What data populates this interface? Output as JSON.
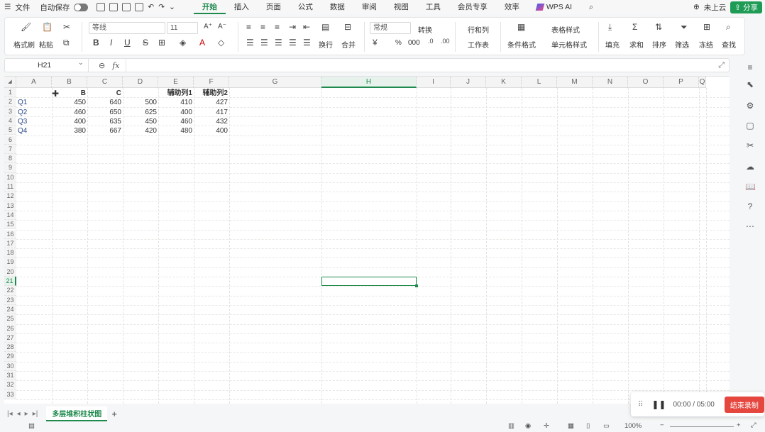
{
  "menu": {
    "file": "文件",
    "autosave": "自动保存",
    "tabs": [
      "开始",
      "插入",
      "页面",
      "公式",
      "数据",
      "审阅",
      "视图",
      "工具",
      "会员专享",
      "效率"
    ],
    "wps_ai": "WPS AI",
    "cloud": "未上云",
    "share": "分享"
  },
  "ribbon": {
    "format_painter": "格式刷",
    "paste": "粘贴",
    "font_name": "等线",
    "font_size": "11",
    "bold": "B",
    "italic": "I",
    "underline": "U",
    "strike": "S",
    "wrap": "换行",
    "merge": "合并",
    "number_format": "常规",
    "convert": "转换",
    "percent": "%",
    "thousands": "000",
    "row_col": "行和列",
    "worksheet": "工作表",
    "cond_format": "条件格式",
    "table_style": "表格样式",
    "cell_style": "单元格样式",
    "fill": "填充",
    "sum": "求和",
    "sort": "排序",
    "filter": "筛选",
    "freeze": "冻结",
    "find": "查找"
  },
  "formula_bar": {
    "name_box": "H21",
    "fx": "fx",
    "content": ""
  },
  "columns": [
    "A",
    "B",
    "C",
    "D",
    "E",
    "F",
    "G",
    "H",
    "I",
    "J",
    "K",
    "L",
    "M",
    "N",
    "O",
    "P",
    "Q"
  ],
  "selected_column": "H",
  "rows": [
    "1",
    "2",
    "3",
    "4",
    "5",
    "6",
    "7",
    "8",
    "9",
    "10",
    "11",
    "12",
    "13",
    "14",
    "15",
    "16",
    "17",
    "18",
    "19",
    "20",
    "21",
    "22",
    "23",
    "24",
    "25",
    "26",
    "27",
    "28",
    "29",
    "30",
    "31",
    "32",
    "33"
  ],
  "selected_row": "21",
  "cells": {
    "header": [
      "",
      "B",
      "C",
      "",
      "辅助列1",
      "辅助列2"
    ],
    "data": [
      [
        "Q1",
        "450",
        "640",
        "500",
        "410",
        "427"
      ],
      [
        "Q2",
        "460",
        "650",
        "625",
        "400",
        "417"
      ],
      [
        "Q3",
        "400",
        "635",
        "450",
        "460",
        "432"
      ],
      [
        "Q4",
        "380",
        "667",
        "420",
        "480",
        "400"
      ]
    ]
  },
  "sheet": {
    "tab_name": "多层堆积柱状图",
    "add": "+"
  },
  "status": {
    "zoom": "100%"
  },
  "recorder": {
    "time": "00:00 / 05:00",
    "stop": "结束录制"
  }
}
